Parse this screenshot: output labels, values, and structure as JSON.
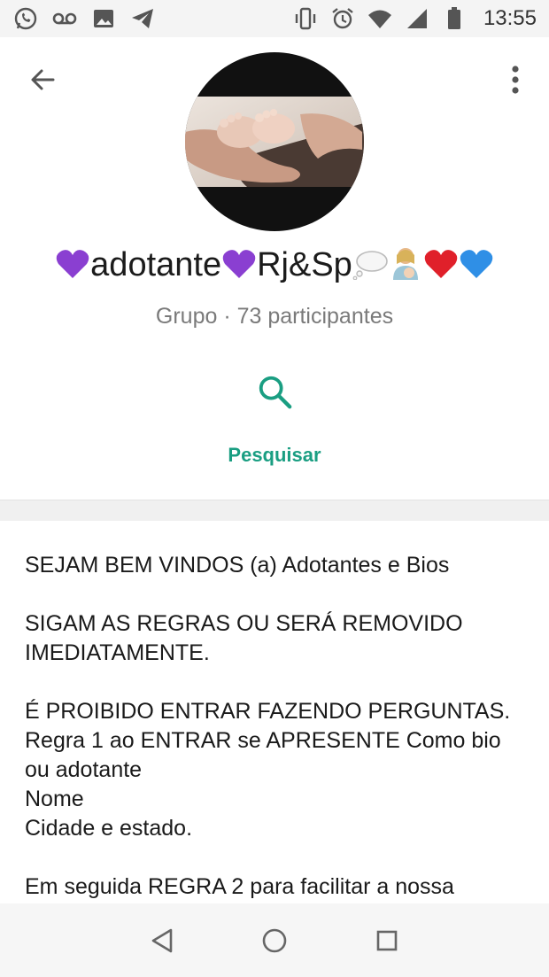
{
  "status_bar": {
    "time": "13:55",
    "left_icons": [
      "whatsapp-icon",
      "voicemail-icon",
      "image-icon",
      "telegram-icon"
    ],
    "right_icons": [
      "vibrate-icon",
      "alarm-icon",
      "wifi-icon",
      "signal-icon",
      "battery-icon"
    ]
  },
  "header": {
    "back_icon": "arrow-left-icon",
    "menu_icon": "more-vertical-icon"
  },
  "group": {
    "name_part1": "adotante",
    "name_part2": "Rj&Sp",
    "subtitle": "Grupo · 73 participantes"
  },
  "actions": {
    "search_label": "Pesquisar"
  },
  "description": {
    "lines": [
      "SEJAM BEM VINDOS (a) Adotantes e Bios",
      "",
      "SIGAM AS REGRAS OU SERÁ REMOVIDO IMEDIATAMENTE.",
      "",
      "É PROIBIDO ENTRAR FAZENDO PERGUNTAS.",
      "Regra 1 ao ENTRAR se APRESENTE Como bio ou adotante",
      "Nome",
      "Cidade e estado.",
      "",
      "Em seguida REGRA 2 para facilitar a nossa"
    ]
  },
  "colors": {
    "accent": "#1a9e82",
    "purple_heart": "#8a3fd1",
    "red_heart": "#e0202a",
    "blue_heart": "#2f8fe6"
  },
  "nav": {
    "icons": [
      "back-triangle-icon",
      "home-circle-icon",
      "recents-square-icon"
    ]
  }
}
